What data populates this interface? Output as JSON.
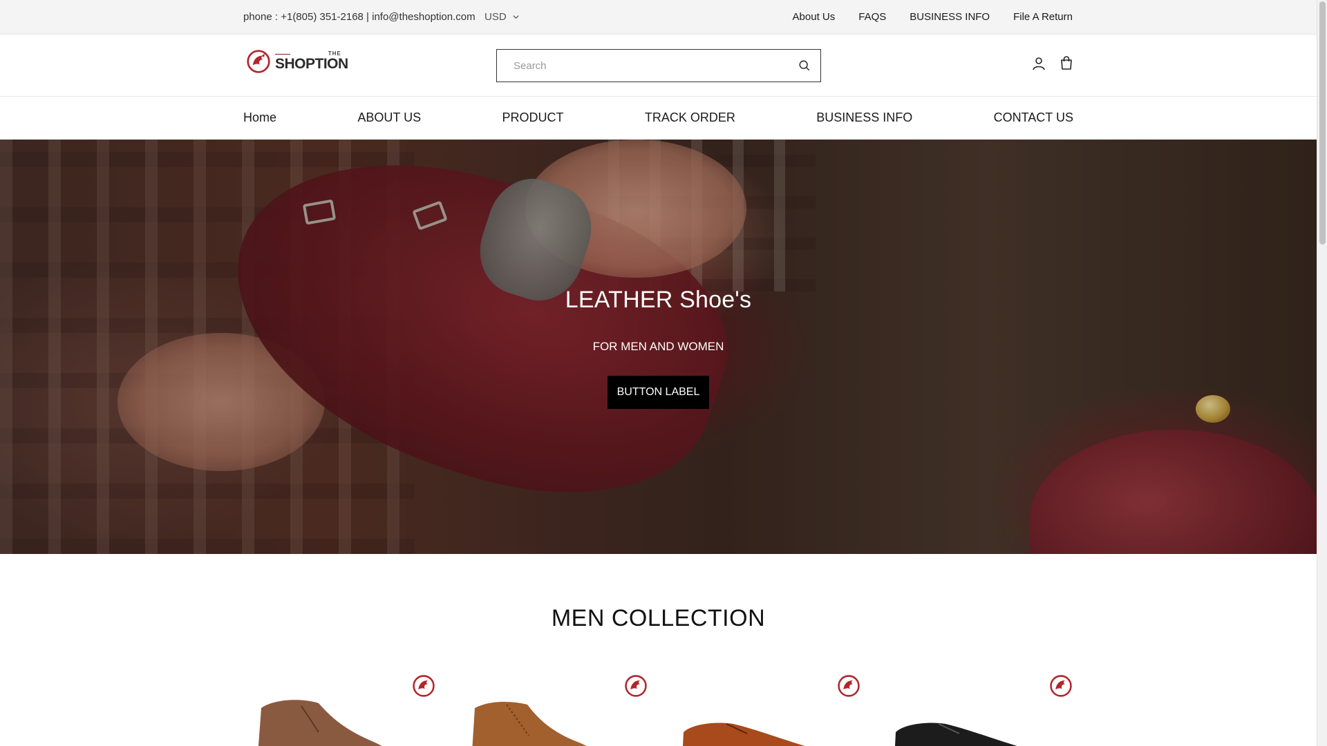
{
  "topbar": {
    "contact": "phone : +1(805) 351-2168 | info@theshoption.com",
    "currency": "USD",
    "links": [
      "About Us",
      "FAQS",
      "BUSINESS INFO",
      "File A Return"
    ]
  },
  "header": {
    "logo_top": "THE",
    "logo_brand": "SHOPTION",
    "search_placeholder": "Search"
  },
  "nav": {
    "items": [
      "Home",
      "ABOUT US",
      "PRODUCT",
      "TRACK ORDER",
      "BUSINESS INFO",
      "CONTACT US"
    ]
  },
  "hero": {
    "title": "LEATHER Shoe's",
    "subtitle": "FOR MEN AND WOMEN",
    "button": "BUTTON LABEL"
  },
  "collection": {
    "title": "MEN COLLECTION",
    "products": [
      {
        "image": "brown-chukka-boot",
        "color": "#8a5a40"
      },
      {
        "image": "tan-brogue-boot",
        "color": "#a2602e"
      },
      {
        "image": "tan-oxford-shoe",
        "color": "#a84a1c"
      },
      {
        "image": "black-oxford-shoe",
        "color": "#1c1c1c"
      }
    ]
  },
  "colors": {
    "brand_red": "#b3252b",
    "button_bg": "#000000",
    "topbar_bg": "#f4f4f4"
  }
}
